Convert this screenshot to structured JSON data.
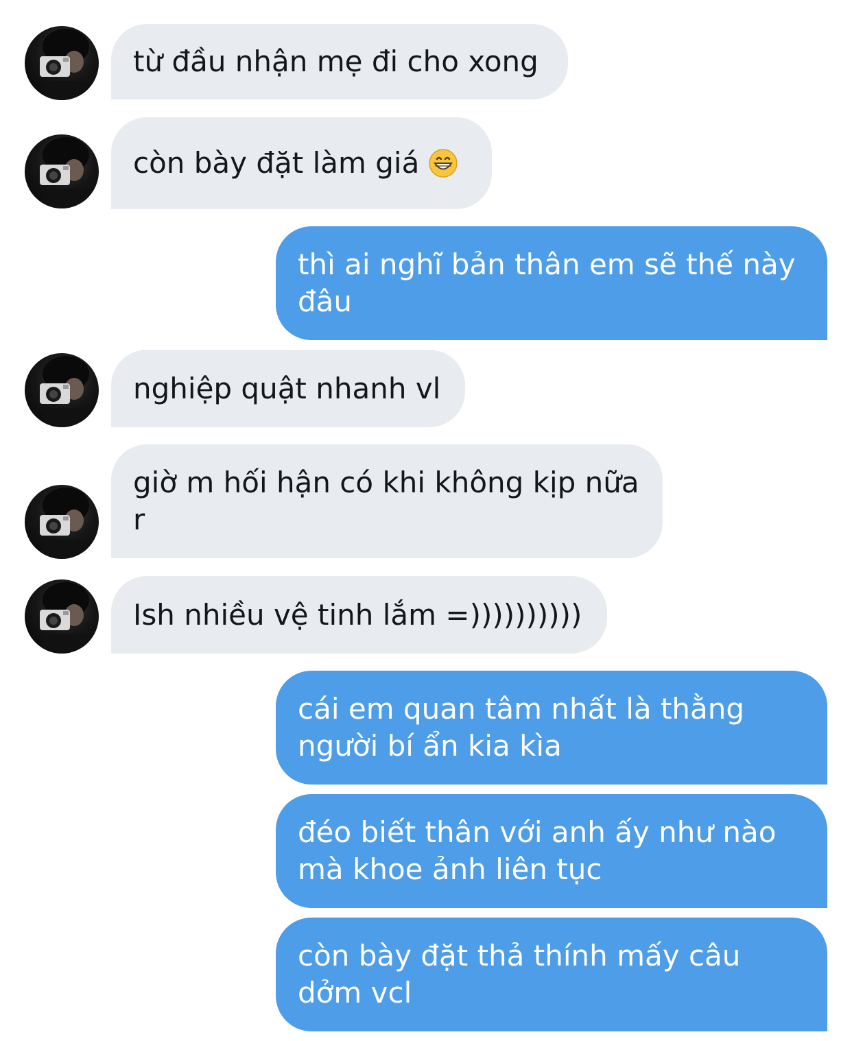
{
  "messages": [
    {
      "side": "incoming",
      "text": "từ đầu nhận mẹ đi cho xong"
    },
    {
      "side": "incoming",
      "text": "còn bày đặt làm giá",
      "emoji": "grinning-face-icon"
    },
    {
      "side": "outgoing",
      "text": "thì ai nghĩ bản thân em sẽ thế này đâu"
    },
    {
      "side": "incoming",
      "text": "nghiệp quật nhanh vl"
    },
    {
      "side": "incoming",
      "text": "giờ m hối hận có khi không kịp nữa r"
    },
    {
      "side": "incoming",
      "text": "Ish nhiều vệ tinh lắm =))))))))))"
    },
    {
      "side": "outgoing",
      "text": "cái em quan tâm nhất là thằng người bí ẩn kia kìa"
    },
    {
      "side": "outgoing",
      "text": "đéo biết thân với anh ấy như nào mà khoe ảnh liên tục"
    },
    {
      "side": "outgoing",
      "text": "còn bày đặt thả thính mấy câu dởm vcl"
    }
  ],
  "colors": {
    "incoming_bubble": "#e8ebef",
    "outgoing_bubble": "#4d9de8",
    "incoming_text": "#14171a",
    "outgoing_text": "#ffffff"
  }
}
